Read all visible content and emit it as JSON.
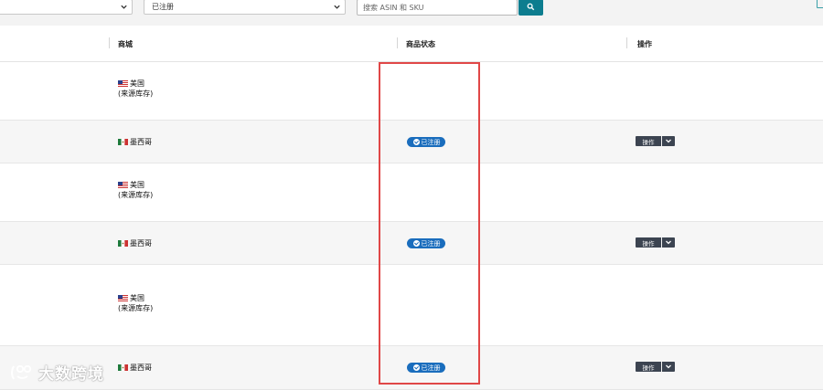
{
  "filters": {
    "status_select": "已注册",
    "search_placeholder": "搜索 ASIN 和 SKU"
  },
  "table": {
    "headers": {
      "marketplace": "商城",
      "status": "商品状态",
      "actions": "操作"
    },
    "rows": [
      {
        "flag": "us-flag-icon",
        "marketplace": "美国",
        "note": "(来源库存)",
        "status": "",
        "action": ""
      },
      {
        "flag": "mx-flag-icon",
        "marketplace": "墨西哥",
        "note": "",
        "status": "已注册",
        "action": "操作"
      },
      {
        "flag": "us-flag-icon",
        "marketplace": "美国",
        "note": "(来源库存)",
        "status": "",
        "action": ""
      },
      {
        "flag": "mx-flag-icon",
        "marketplace": "墨西哥",
        "note": "",
        "status": "已注册",
        "action": "操作"
      },
      {
        "flag": "us-flag-icon",
        "marketplace": "美国",
        "note": "(来源库存)",
        "status": "",
        "action": ""
      },
      {
        "flag": "mx-flag-icon",
        "marketplace": "墨西哥",
        "note": "",
        "status": "已注册",
        "action": "操作"
      }
    ]
  },
  "watermark": "大数跨境",
  "colors": {
    "badge": "#1a6dbd",
    "search_button": "#0d7d8f",
    "highlight": "#e04747",
    "action_button": "#3c4451"
  }
}
